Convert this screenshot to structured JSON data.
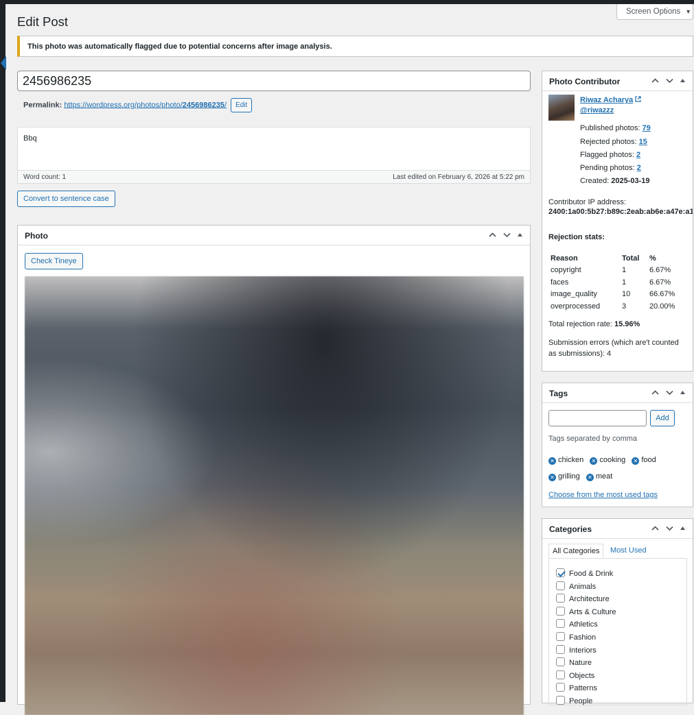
{
  "header": {
    "screen_options": "Screen Options",
    "page_title": "Edit Post"
  },
  "notice": {
    "text": "This photo was automatically flagged due to potential concerns after image analysis."
  },
  "post": {
    "title": "2456986235",
    "permalink_label": "Permalink:",
    "permalink_base": "https://wordpress.org/photos/photo/",
    "permalink_slug": "2456986235",
    "permalink_trail": "/",
    "edit_label": "Edit",
    "content": "Bbq",
    "word_count": "Word count: 1",
    "last_edited": "Last edited on February 6, 2026 at 5:22 pm",
    "sentence_case_label": "Convert to sentence case"
  },
  "photo_box": {
    "title": "Photo",
    "tineye_label": "Check Tineye"
  },
  "contributor": {
    "title": "Photo Contributor",
    "name": "Riwaz Acharya",
    "handle": "@riwazzz",
    "stats": [
      {
        "label": "Published photos: ",
        "value": "79",
        "link": true
      },
      {
        "label": "Rejected photos: ",
        "value": "15",
        "link": true
      },
      {
        "label": "Flagged photos: ",
        "value": "2",
        "link": true
      },
      {
        "label": "Pending photos: ",
        "value": "2",
        "link": true
      },
      {
        "label": "Created: ",
        "value": "2025-03-19",
        "link": false
      }
    ],
    "ip_label": "Contributor IP address:",
    "ip_value": "2400:1a00:5b27:b89c:2eab:ab6e:a47e:a1",
    "rejection_title": "Rejection stats:",
    "rejection_headers": [
      "Reason",
      "Total",
      "%"
    ],
    "rejection_rows": [
      [
        "copyright",
        "1",
        "6.67%"
      ],
      [
        "faces",
        "1",
        "6.67%"
      ],
      [
        "image_quality",
        "10",
        "66.67%"
      ],
      [
        "overprocessed",
        "3",
        "20.00%"
      ]
    ],
    "rejection_rate_label": "Total rejection rate: ",
    "rejection_rate_value": "15.96%",
    "submission_errors": "Submission errors (which are't counted as submissions): 4"
  },
  "tags": {
    "title": "Tags",
    "input_value": "",
    "add_label": "Add",
    "help": "Tags separated by comma",
    "items": [
      "chicken",
      "cooking",
      "food",
      "grilling",
      "meat"
    ],
    "most_used_link": "Choose from the most used tags"
  },
  "categories": {
    "title": "Categories",
    "tab_all": "All Categories",
    "tab_most_used": "Most Used",
    "items": [
      {
        "label": "Food & Drink",
        "checked": true
      },
      {
        "label": "Animals",
        "checked": false
      },
      {
        "label": "Architecture",
        "checked": false
      },
      {
        "label": "Arts & Culture",
        "checked": false
      },
      {
        "label": "Athletics",
        "checked": false
      },
      {
        "label": "Fashion",
        "checked": false
      },
      {
        "label": "Interiors",
        "checked": false
      },
      {
        "label": "Nature",
        "checked": false
      },
      {
        "label": "Objects",
        "checked": false
      },
      {
        "label": "Patterns",
        "checked": false
      },
      {
        "label": "People",
        "checked": false
      }
    ]
  },
  "colors": {
    "accent": "#2271b1",
    "notice_warning": "#dba617",
    "admin_bar": "#1d2327"
  },
  "icons": {
    "box_controls": [
      "chevron-up-icon",
      "chevron-down-icon",
      "toggle-triangle-icon"
    ],
    "external_link": "external-link-icon",
    "tag_remove": "remove-tag-icon"
  }
}
